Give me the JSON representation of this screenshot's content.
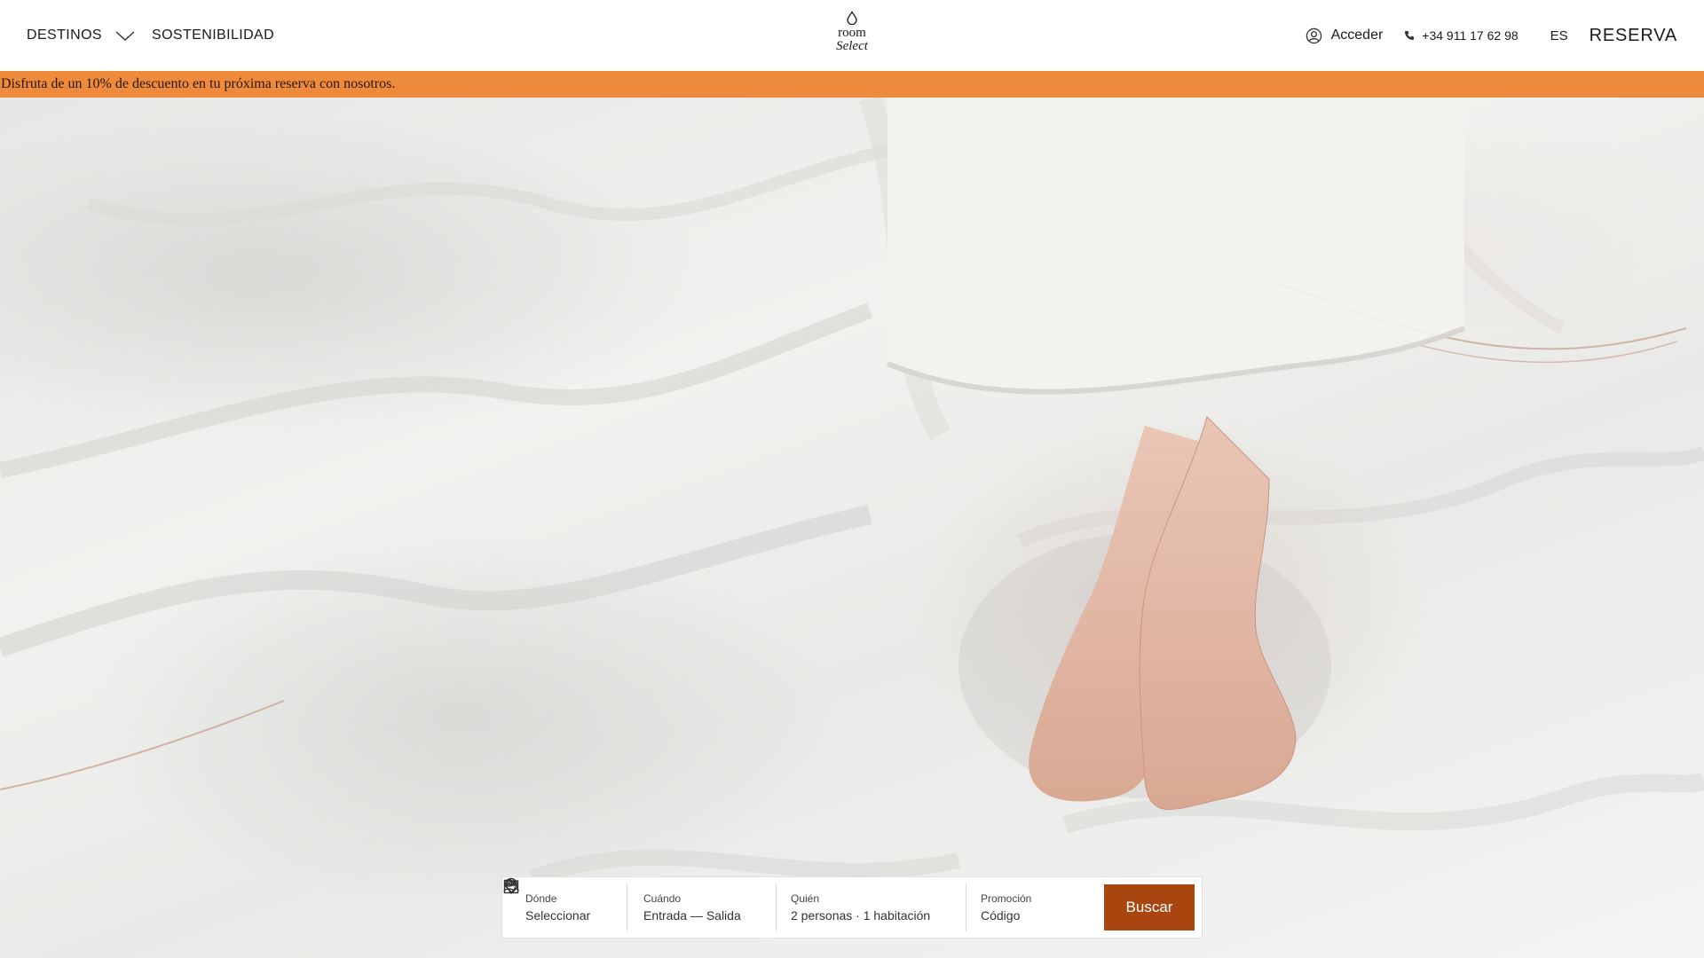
{
  "header": {
    "nav": {
      "destinos": "DESTINOS",
      "sostenibilidad": "SOSTENIBILIDAD"
    },
    "logo": {
      "line1": "room",
      "line2": "Select"
    },
    "acceder": "Acceder",
    "phone": "+34 911 17 62 98",
    "language": "ES",
    "reserva": "RESERVA"
  },
  "promo_banner": {
    "text": "Disfruta de un 10% de descuento en tu próxima reserva con nosotros.",
    "background": "#ee8a3b"
  },
  "search": {
    "where": {
      "label": "Dónde",
      "value": "Seleccionar",
      "icon": "map-pin-icon"
    },
    "when": {
      "label": "Cuándo",
      "value": "Entrada — Salida",
      "icon": "calendar-icon"
    },
    "who": {
      "label": "Quién",
      "value": "2 personas · 1 habitación",
      "icon": "people-icon"
    },
    "promo": {
      "label": "Promoción",
      "value": "Código",
      "icon": "tag-icon"
    },
    "submit": "Buscar",
    "accent": "#a9450f"
  }
}
